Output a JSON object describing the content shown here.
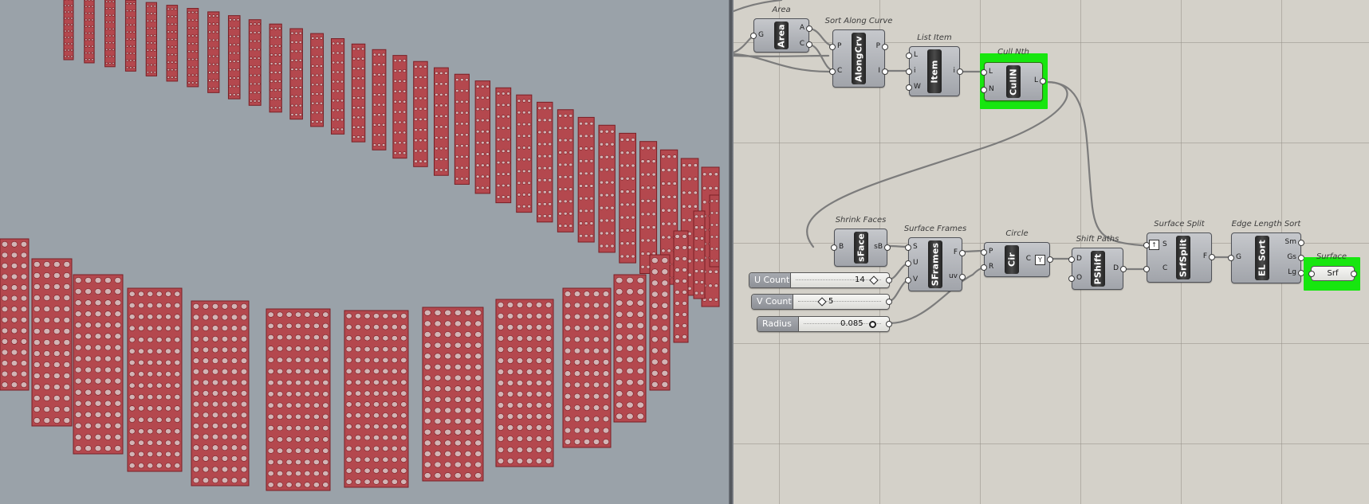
{
  "viewport": {
    "background": "#9aa2a9",
    "panel_color": "#b4484e",
    "panel_edge": "#7a1f25"
  },
  "components": {
    "area": {
      "title": "Area",
      "nick": "Area",
      "inputs": [
        "G"
      ],
      "outputs": [
        "A",
        "C"
      ]
    },
    "sort_along_curve": {
      "title": "Sort Along Curve",
      "nick": "AlongCrv",
      "inputs": [
        "P",
        "C"
      ],
      "outputs": [
        "P",
        "I"
      ]
    },
    "list_item": {
      "title": "List Item",
      "nick": "Item",
      "inputs": [
        "L",
        "i",
        "W"
      ],
      "outputs": [
        "i"
      ]
    },
    "cull_nth": {
      "title": "Cull Nth",
      "nick": "CullN",
      "inputs": [
        "L",
        "N"
      ],
      "outputs": [
        "L"
      ]
    },
    "shrink_faces": {
      "title": "Shrink Faces",
      "nick": "sFace",
      "inputs": [
        "B"
      ],
      "outputs": [
        "sB"
      ]
    },
    "surface_frames": {
      "title": "Surface Frames",
      "nick": "SFrames",
      "inputs": [
        "S",
        "U",
        "V"
      ],
      "outputs": [
        "F",
        "uv"
      ]
    },
    "circle": {
      "title": "Circle",
      "nick": "Cir",
      "inputs": [
        "P",
        "R"
      ],
      "outputs": [
        "C"
      ]
    },
    "shift_paths": {
      "title": "Shift Paths",
      "nick": "PShift",
      "inputs": [
        "D",
        "O"
      ],
      "outputs": [
        "D"
      ]
    },
    "surface_split": {
      "title": "Surface Split",
      "nick": "SrfSplit",
      "inputs": [
        "S",
        "C"
      ],
      "outputs": [
        "F"
      ]
    },
    "edge_length_sort": {
      "title": "Edge Length Sort",
      "nick": "EL Sort",
      "inputs": [
        "G"
      ],
      "outputs": [
        "Sm",
        "Gs",
        "Lg"
      ]
    },
    "surface": {
      "title": "Surface",
      "nick": "Srf"
    }
  },
  "sliders": {
    "u_count": {
      "label": "U Count",
      "value": "14"
    },
    "v_count": {
      "label": "V Count",
      "value": "5"
    },
    "radius": {
      "label": "Radius",
      "value": "0.085"
    }
  },
  "colors": {
    "selection": "#17e60f",
    "wire": "#7c7c7c",
    "canvas": "#d4d1c9"
  }
}
